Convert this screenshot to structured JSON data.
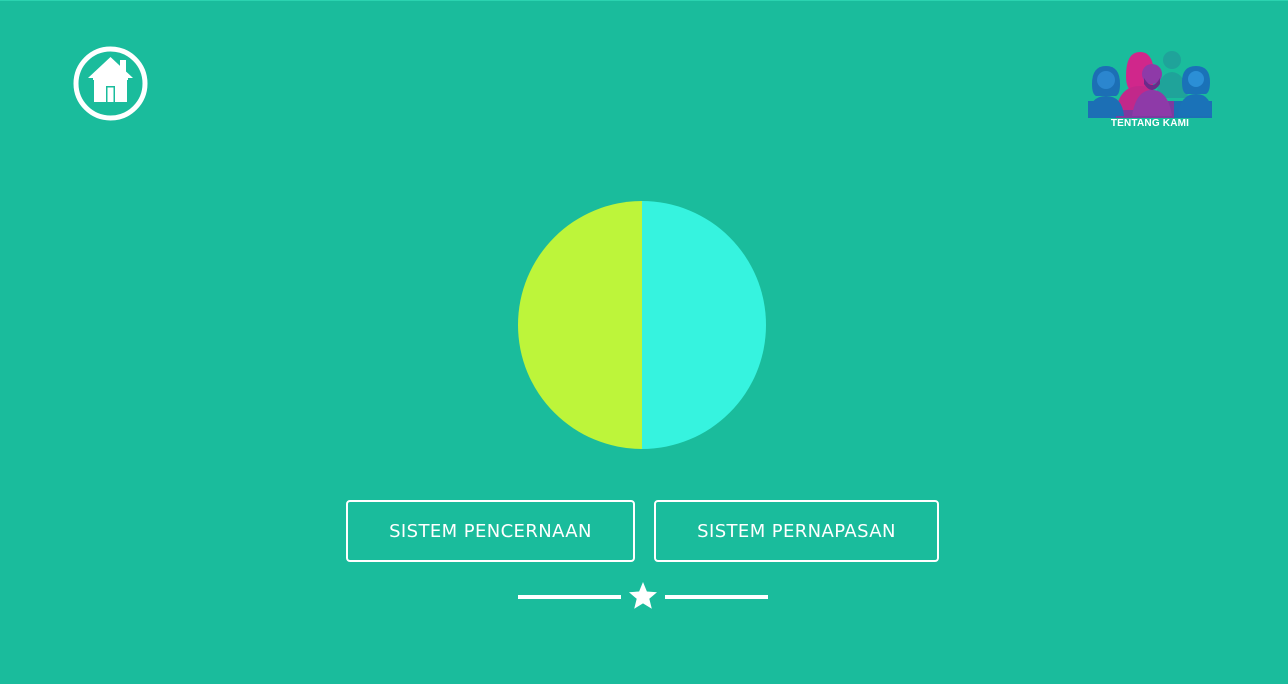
{
  "colors": {
    "background": "#1abc9c",
    "left_half": "#bdf53a",
    "right_half": "#36f3df",
    "outline": "#ffffff"
  },
  "header": {
    "home_icon": "home-icon",
    "about": {
      "icon": "people-group-icon",
      "label": "TENTANG KAMI"
    }
  },
  "main": {
    "circle_icon": "split-circle-icon",
    "buttons": [
      {
        "label": "SISTEM PENCERNAAN"
      },
      {
        "label": "SISTEM PERNAPASAN"
      }
    ],
    "divider_icon": "star-icon"
  }
}
